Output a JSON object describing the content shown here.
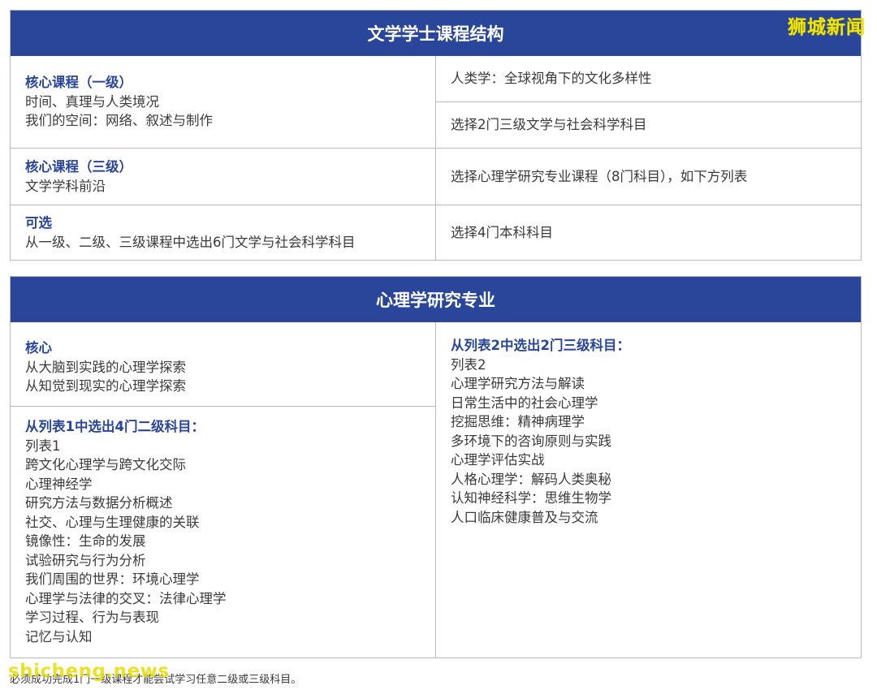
{
  "watermark_top": "狮城新闻",
  "watermark_bottom": "shicheng.news",
  "table1": {
    "title": "文学学士课程结构",
    "left": [
      {
        "label": "核心课程（一级）",
        "lines": [
          "时间、真理与人类境况",
          "我们的空间：网络、叙述与制作"
        ]
      },
      {
        "label": "核心课程（三级）",
        "lines": [
          "文学学科前沿"
        ]
      },
      {
        "label": "可选",
        "lines": [
          "从一级、二级、三级课程中选出6门文学与社会科学科目"
        ]
      }
    ],
    "right": [
      "人类学：全球视角下的文化多样性",
      "选择2门三级文学与社会科学科目",
      "选择心理学研究专业课程（8门科目），如下方列表",
      "选择4门本科科目"
    ]
  },
  "table2": {
    "title": "心理学研究专业",
    "core": {
      "label": "核心",
      "lines": [
        "从大脑到实践的心理学探索",
        "从知觉到现实的心理学探索"
      ]
    },
    "list1": {
      "label": "从列表1中选出4门二级科目：",
      "lines": [
        "列表1",
        "跨文化心理学与跨文化交际",
        "心理神经学",
        "研究方法与数据分析概述",
        "社交、心理与生理健康的关联",
        "镜像性：生命的发展",
        "试验研究与行为分析",
        "我们周围的世界：环境心理学",
        "心理学与法律的交叉：法律心理学",
        "学习过程、行为与表现",
        "记忆与认知"
      ]
    },
    "list2": {
      "label": "从列表2中选出2门三级科目：",
      "lines": [
        "列表2",
        "心理学研究方法与解读",
        "日常生活中的社会心理学",
        "挖掘思维：精神病理学",
        "多环境下的咨询原则与实践",
        "心理学评估实战",
        "人格心理学：解码人类奥秘",
        "认知神经科学：思维生物学",
        "人口临床健康普及与交流"
      ]
    }
  },
  "footnote": "必须成功完成1门一级课程才能尝试学习任意二级或三级科目。"
}
